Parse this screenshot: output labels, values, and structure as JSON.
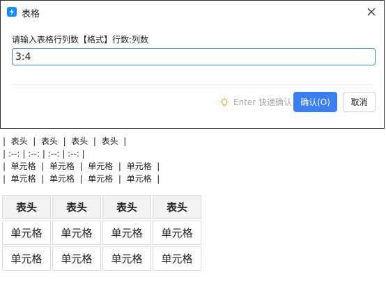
{
  "dialog": {
    "title": "表格",
    "prompt": "请输入表格行列数【格式】行数:列数",
    "input_value": "3:4",
    "hint_text": "Enter 快速确认",
    "confirm_label": "确认(O)",
    "cancel_label": "取消"
  },
  "markdown_source": {
    "lines": [
      "|  表头  |  表头  |  表头  |  表头  |",
      "| :--: | :--: | :--: | :--: |",
      "|  单元格  |  单元格  |  单元格  |  单元格  |",
      "|  单元格  |  单元格  |  单元格  |  单元格  |"
    ]
  },
  "rendered_table": {
    "headers": [
      "表头",
      "表头",
      "表头",
      "表头"
    ],
    "rows": [
      [
        "单元格",
        "单元格",
        "单元格",
        "单元格"
      ],
      [
        "单元格",
        "单元格",
        "单元格",
        "单元格"
      ]
    ]
  },
  "colors": {
    "accent": "#3b7ef0",
    "app_icon": "#1b8cf2",
    "hint_text": "#a8a8a8",
    "header_cell_bg": "#f2f2f2"
  }
}
